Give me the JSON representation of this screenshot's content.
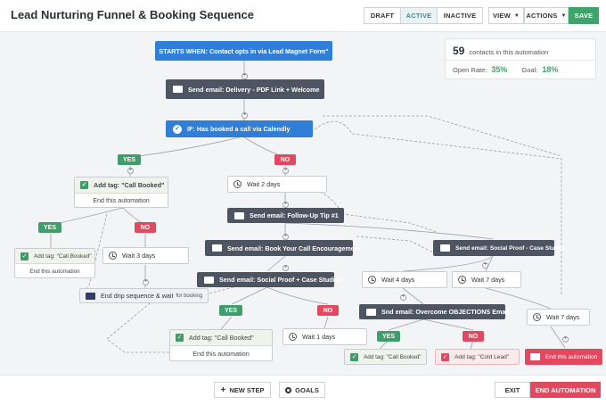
{
  "header": {
    "title": "Lead Nurturing Funnel & Booking Sequence",
    "status_buttons": [
      "DRAFT",
      "ACTIVE",
      "INACTIVE"
    ],
    "active_status": "ACTIVE",
    "view_label": "VIEW",
    "actions_label": "ACTIONS",
    "save_label": "SAVE"
  },
  "stats": {
    "contacts_count": "59",
    "contacts_label": "contacts in this automation",
    "open_rate_label": "Open Rate:",
    "open_rate_value": "35%",
    "goal_label": "Goal:",
    "goal_value": "18%"
  },
  "flow": {
    "start": "STARTS WHEN: Contact opts in via Lead Magnet Form\"",
    "email_delivery": "Send email: Delivery - PDF Link + Welcome",
    "if_booked": "IF: Has booked a call via Calendly",
    "yes": "YES",
    "no": "NO",
    "tag_call_booked": "Add tag: \"Call Booked\"",
    "end_automation": "End this automation",
    "wait_2_days": "Wait 2 days",
    "email_followup": "Send email: Follow-Up Tip #1",
    "tag_call_booked_small": "Add tag: \"Call Booked\"",
    "end_automation_small": "End this automation",
    "wait_3_days": "Wait 3 days",
    "email_book_call": "Send email: Book Your Call Encouragement",
    "email_case_studies_right": "Send email: Social Proof - Case Studies",
    "email_social_proof": "Send email: Social Proof + Case Studies",
    "drip_end": "End drip sequence & wait",
    "drip_end_suffix": "for booking",
    "wait_4_days": "Wait 4 days",
    "wait_7_days_a": "Wait 7 days",
    "wait_7_days_b": "Wait 7 days",
    "email_objections": "Snd email: Overcome OBJECTIONS Email",
    "wait_1_days": "Wait 1 days",
    "tag_call_booked_bottom": "Add tag: \"Call Booked\"",
    "end_automation_bottom": "End this automation",
    "tag_call_booked_tiny": "Add tag: \"Call Booked\"",
    "tag_cold_lead": "Add tag: \"Cold Lead\"",
    "end_automation_red": "End this automation"
  },
  "footer": {
    "new_step_label": "NEW STEP",
    "goals_label": "GOALS",
    "exit_label": "EXIT",
    "end_automation_label": "END AUTOMATION"
  },
  "colors": {
    "accent_teal": "#3a8f8f",
    "save_green": "#3fa46a",
    "trigger_blue": "#2f7fd8",
    "email_dark": "#4e5562",
    "yes_green": "#3f9d6b",
    "no_red": "#e2485f"
  },
  "icons": [
    "envelope-icon",
    "clock-icon",
    "check-icon",
    "plus-icon",
    "goals-icon",
    "chevron-down-icon"
  ]
}
